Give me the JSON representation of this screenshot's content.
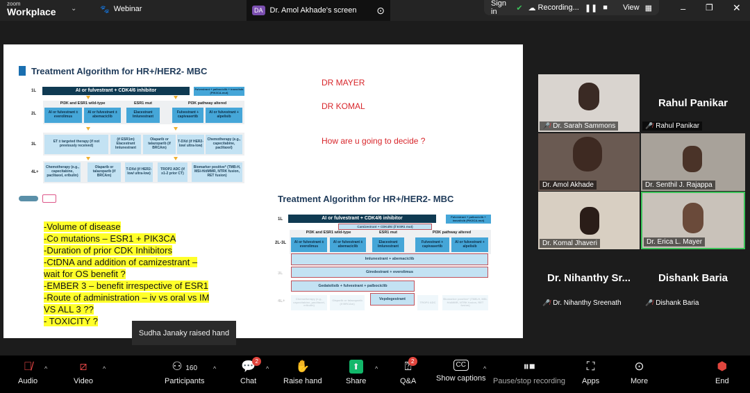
{
  "topbar": {
    "brand_small": "zoom",
    "brand": "Workplace",
    "webinar": "Webinar",
    "screen_initials": "DA",
    "screen_label": "Dr. Amol Akhade's screen",
    "sign_in": "Sign in",
    "recording": "Recording...",
    "view": "View"
  },
  "slide": {
    "title1": "Treatment Algorithm for HR+/HER2- MBC",
    "alg1": {
      "l1": "1L",
      "l2": "2L",
      "l3": "3L",
      "l4": "4L+",
      "first_line": "AI or fulvestrant + CDK4/6 inhibitor",
      "first_alt": "Fulvestrant + palbociclib + inavolisib (PIK3CA-mut)",
      "h1": "PI3K and ESR1 wild-type",
      "h2": "ESR1 mut",
      "h3": "PI3K pathway altered",
      "r2": [
        "AI or fulvestrant ± everolimus",
        "AI or fulvestrant ± abemaciclib",
        "Elacestrant Imlunestrant",
        "Fulvestrant + capivasertib",
        "AI or fulvestrant + alpelisib"
      ],
      "r3": [
        "ET ± targeted therapy (if not previously received)",
        "(if ESR1m) Elacestrant Imlunestrant",
        "Olaparib or talazoparib (if BRCAm)",
        "T-DXd (if HER2-low/ ultra-low)",
        "Chemotherapy (e.g., capecitabine, paclitaxel)"
      ],
      "r4": [
        "Chemotherapy (e.g., capecitabine, paclitaxel, eribulin)",
        "Olaparib or talazoparib (if BRCAm)",
        "T-DXd (if HER2-low/ ultra-low)",
        "TROP2 ADC (if ≥1-2 prior CT)",
        "Biomarker positive* (TMB-H, MSI-H/dMMR, NTRK fusion, RET fusion)"
      ]
    },
    "notes": [
      "DR MAYER",
      "DR KOMAL",
      "How are u going to decide ?"
    ],
    "bullets": [
      "-Volume of disease",
      "-Co mutations – ESR1 + PIK3CA",
      "-Duration of prior CDK Inhibitors",
      "-CtDNA and addition of camizestrant –",
      "wait for OS benefit ?",
      "-EMBER 3 – benefit irrespective of ESR1",
      "-Route of administration – iv vs oral vs IM",
      "VS ALL 3 ??",
      "-  TOXICITY ?"
    ],
    "title2": "Treatment Algorithm for HR+/HER2- MBC",
    "alg2": {
      "l1": "1L",
      "l23": "2L-3L",
      "l3": "3L",
      "l4": "4L+",
      "first_line": "AI or fulvestrant + CDK4/6 inhibitor",
      "first_alt": "Fulvestrant + palbociclib + inavolisib (PIK3CA-mut)",
      "cami": "Camizestrant + CDK4/6i (if ESR1 mut)",
      "h1": "PI3K and ESR1 wild-type",
      "h2": "ESR1 mut",
      "h3": "PI3K pathway altered",
      "r2": [
        "AI or fulvestrant ± everolimus",
        "AI or fulvestrant ± abemaciclib",
        "Elacestrant Imlunestrant",
        "Fulvestrant + capivasertib",
        "AI or fulvestrant + alpelisib"
      ],
      "imlu": "Imlunestrant + abemaciclib",
      "gire": "Giredestrant + everolimus",
      "geda": "Gedatolisib + fulvestrant + palbociclib",
      "vepd": "Vepdegestrant",
      "r4": [
        "Chemotherapy (e.g., capecitabine, paclitaxel, eribulin)",
        "Olaparib or talazoparib (if BRCAm)",
        "TROP2 ADC",
        "Biomarker positive* (TMB-H, MSI-H/dMMR, NTRK fusion, RET fusion)"
      ]
    }
  },
  "tooltip": "Sudha Janaky raised hand",
  "participants": {
    "tiles": [
      {
        "name": "Dr. Sarah Sammons"
      },
      {
        "big": "Rahul Panikar",
        "name": "Rahul Panikar"
      },
      {
        "name": "Dr. Amol Akhade"
      },
      {
        "name": "Dr. Senthil J. Rajappa"
      },
      {
        "name": "Dr. Komal Jhaveri"
      },
      {
        "name": "Dr. Erica L. Mayer"
      },
      {
        "big": "Dr. Nihanthy Sr...",
        "name": "Dr. Nihanthy Sreenath"
      },
      {
        "big": "Dishank Baria",
        "name": "Dishank Baria"
      }
    ]
  },
  "toolbar": {
    "audio": "Audio",
    "video": "Video",
    "participants": "Participants",
    "participant_count": "160",
    "chat": "Chat",
    "chat_badge": "2",
    "raise": "Raise hand",
    "share": "Share",
    "qa": "Q&A",
    "qa_badge": "2",
    "captions": "Show captions",
    "record": "Pause/stop recording",
    "apps": "Apps",
    "more": "More",
    "end": "End"
  },
  "colors": {
    "share": "#12b76a",
    "end": "#e0453d",
    "highlight": "#ffff2a",
    "note_red": "#d8262b"
  }
}
